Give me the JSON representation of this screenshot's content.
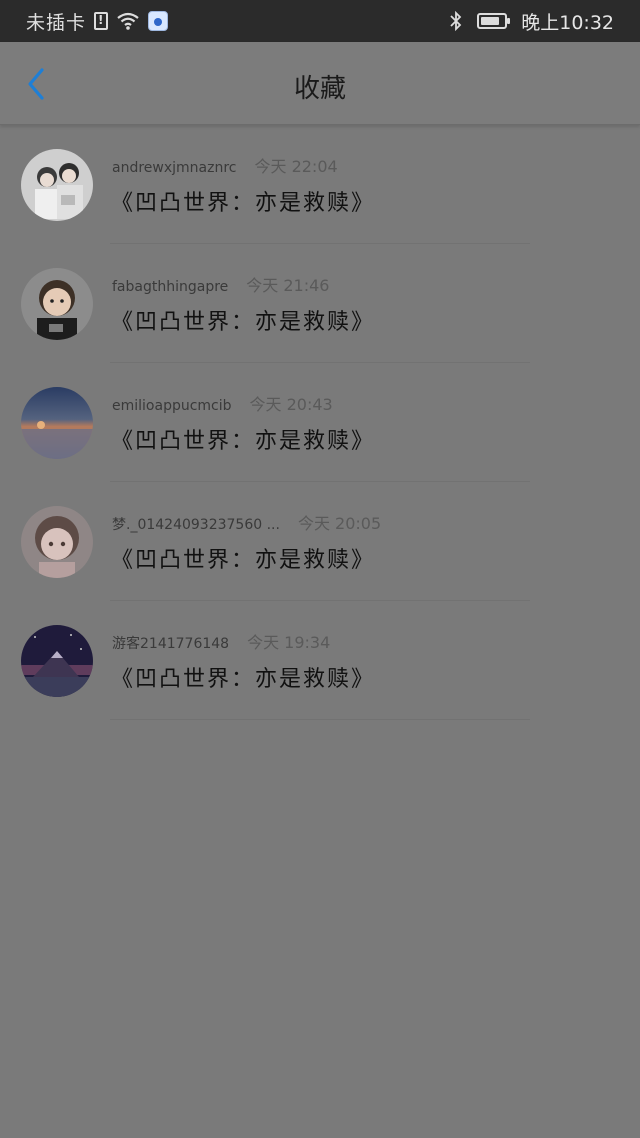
{
  "status_bar": {
    "carrier": "未插卡",
    "time": "晚上10:32",
    "icons": [
      "sim-alert-icon",
      "wifi-icon",
      "app-notification-icon",
      "bluetooth-icon",
      "battery-icon"
    ]
  },
  "header": {
    "title": "收藏",
    "back_icon": "chevron-left-icon",
    "accent": "#1e7fd6"
  },
  "favorites": [
    {
      "user": "andrewxjmnaznrc",
      "time": "今天 22:04",
      "title": "《凹凸世界：亦是救赎》",
      "avatar": "two-girls-photo"
    },
    {
      "user": "fabagthhingapre",
      "time": "今天 21:46",
      "title": "《凹凸世界：亦是救赎》",
      "avatar": "child-photo"
    },
    {
      "user": "emilioappucmcib",
      "time": "今天 20:43",
      "title": "《凹凸世界：亦是救赎》",
      "avatar": "sunset-sea-photo"
    },
    {
      "user": "梦._01424093237560 ...",
      "time": "今天 20:05",
      "title": "《凹凸世界：亦是救赎》",
      "avatar": "anime-girl-photo"
    },
    {
      "user": "游客2141776148",
      "time": "今天 19:34",
      "title": "《凹凸世界：亦是救赎》",
      "avatar": "mountain-night-photo"
    }
  ]
}
